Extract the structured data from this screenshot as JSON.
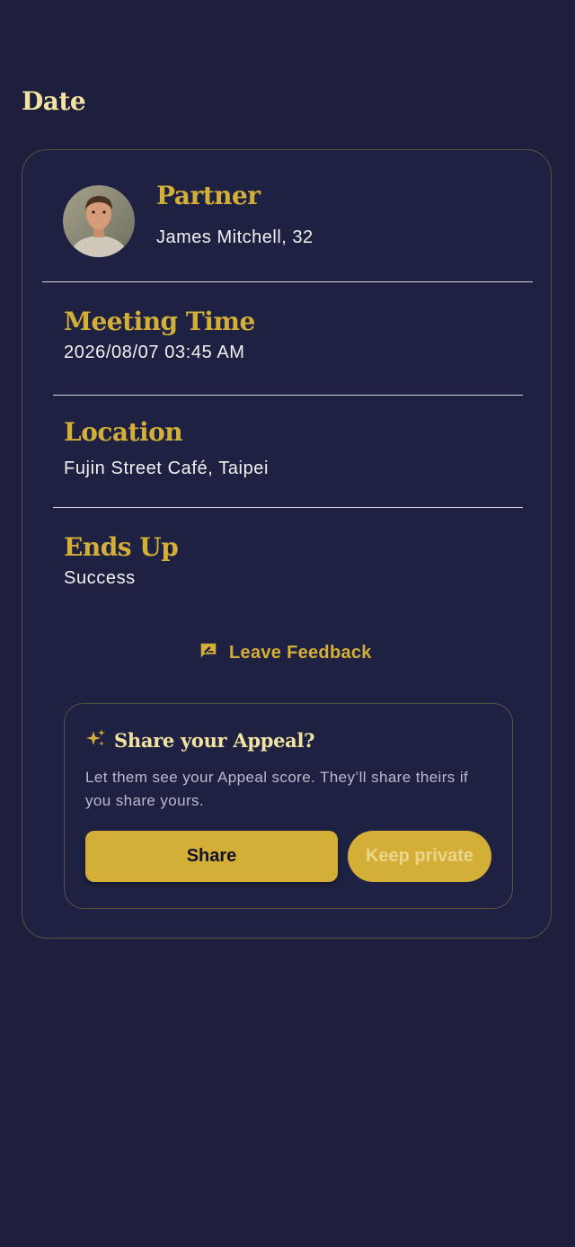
{
  "page": {
    "title": "Date"
  },
  "partner": {
    "label": "Partner",
    "name": "James Mitchell, 32"
  },
  "sections": [
    {
      "label": "Meeting Time",
      "value": "2026/08/07 03:45 AM"
    },
    {
      "label": "Location",
      "value": "Fujin Street Café, Taipei"
    },
    {
      "label": "Ends Up",
      "value": "Success"
    }
  ],
  "feedback": {
    "label": "Leave Feedback",
    "icon": "rate-review-icon"
  },
  "appeal": {
    "icon": "sparkles-icon",
    "title": "Share your Appeal?",
    "description": "Let them see your Appeal score. They’ll share theirs if you share yours.",
    "share_label": "Share",
    "private_label": "Keep private"
  },
  "colors": {
    "background": "#1e1f3d",
    "accent": "#d4af37",
    "title": "#f3e3a3"
  }
}
